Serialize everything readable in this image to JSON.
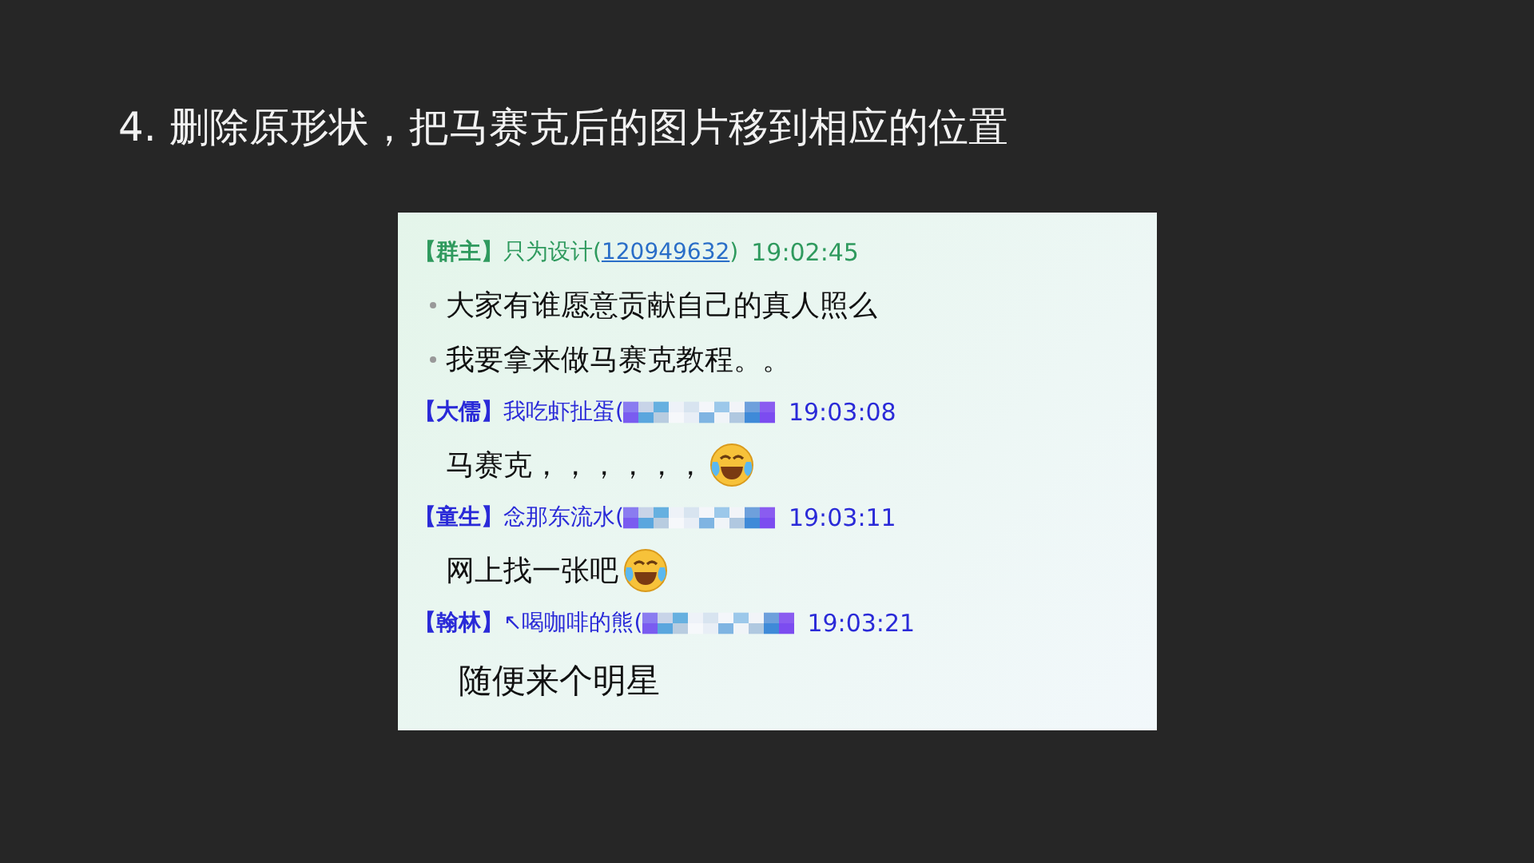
{
  "title": "4. 删除原形状，把马赛克后的图片移到相应的位置",
  "chat": [
    {
      "sender": {
        "rank": "【群主】",
        "name": "只为设计(",
        "id": "120949632",
        "close": ")",
        "time": "19:02:45",
        "color": "#2f9a5e"
      },
      "lines": [
        {
          "text": "大家有谁愿意贡献自己的真人照么",
          "bullet": true,
          "kind": "normal"
        },
        {
          "text": "我要拿来做马赛克教程。。",
          "bullet": true,
          "kind": "normal"
        }
      ]
    },
    {
      "sender": {
        "rank": "【大儒】",
        "name": "我吃虾扯蛋(",
        "masked": true,
        "time": "19:03:08",
        "color": "#2a2ad8"
      },
      "lines": [
        {
          "text": "马赛克，，，，，，",
          "emoji": true,
          "kind": "normal"
        }
      ]
    },
    {
      "sender": {
        "rank": "【童生】",
        "name": "念那东流水(",
        "masked": true,
        "time": "19:03:11",
        "color": "#2a2ad8"
      },
      "lines": [
        {
          "text": "网上找一张吧",
          "emoji": true,
          "kind": "normal"
        }
      ]
    },
    {
      "sender": {
        "rank": "【翰林】",
        "name": "↖喝咖啡的熊(",
        "masked": true,
        "time": "19:03:21",
        "color": "#2a2ad8"
      },
      "lines": [
        {
          "text": "随便来个明星",
          "kind": "large"
        }
      ]
    }
  ]
}
